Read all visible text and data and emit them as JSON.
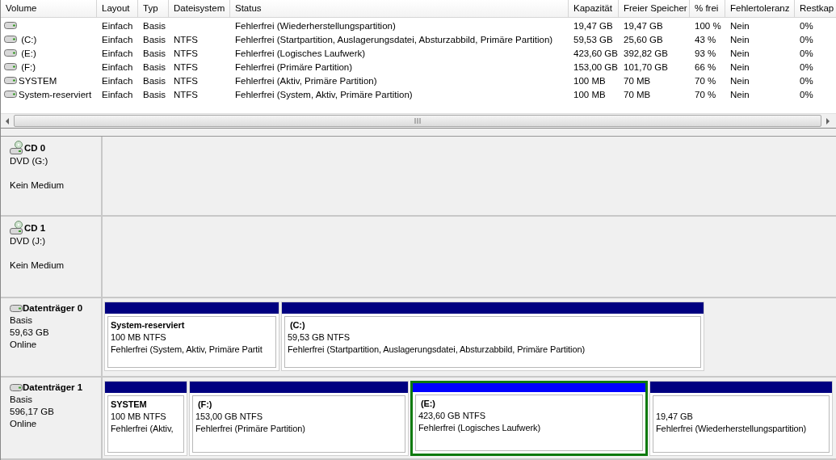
{
  "table": {
    "columns": [
      "Volume",
      "Layout",
      "Typ",
      "Dateisystem",
      "Status",
      "Kapazität",
      "Freier Speicher",
      "% frei",
      "Fehlertoleranz",
      "Restkap"
    ],
    "rows": [
      {
        "layout": "Einfach",
        "type": "Basis",
        "status": "Fehlerfrei (Wiederherstellungspartition)",
        "capacity": "19,47 GB",
        "free": "19,47 GB",
        "percent_free": "100 %",
        "fault_tolerance": "Nein",
        "column_10": "0%"
      },
      {
        "volume": " (C:)",
        "layout": "Einfach",
        "type": "Basis",
        "filesystem": "NTFS",
        "status": "Fehlerfrei (Startpartition, Auslagerungsdatei, Absturzabbild, Primäre Partition)",
        "capacity": "59,53 GB",
        "free": "25,60 GB",
        "percent_free": "43 %",
        "fault_tolerance": "Nein",
        "column_10": "0%"
      },
      {
        "volume": " (E:)",
        "layout": "Einfach",
        "type": "Basis",
        "filesystem": "NTFS",
        "status": "Fehlerfrei (Logisches Laufwerk)",
        "capacity": "423,60 GB",
        "free": "392,82 GB",
        "percent_free": "93 %",
        "fault_tolerance": "Nein",
        "column_10": "0%"
      },
      {
        "volume": " (F:)",
        "layout": "Einfach",
        "type": "Basis",
        "filesystem": "NTFS",
        "status": "Fehlerfrei (Primäre Partition)",
        "capacity": "153,00 GB",
        "free": "101,70 GB",
        "percent_free": "66 %",
        "fault_tolerance": "Nein",
        "column_10": "0%"
      },
      {
        "volume": "SYSTEM",
        "layout": "Einfach",
        "type": "Basis",
        "filesystem": "NTFS",
        "status": "Fehlerfrei (Aktiv, Primäre Partition)",
        "capacity": "100 MB",
        "free": "70 MB",
        "percent_free": "70 %",
        "fault_tolerance": "Nein",
        "column_10": "0%"
      },
      {
        "volume": "System-reserviert",
        "layout": "Einfach",
        "type": "Basis",
        "filesystem": "NTFS",
        "status": "Fehlerfrei (System, Aktiv, Primäre Partition)",
        "capacity": "100 MB",
        "free": "70 MB",
        "percent_free": "70 %",
        "fault_tolerance": "Nein",
        "column_10": "0%"
      }
    ]
  },
  "disks": [
    {
      "kind": "cd",
      "name": "CD 0",
      "lines": [
        "DVD (G:)",
        "Kein Medium"
      ]
    },
    {
      "kind": "cd",
      "name": "CD 1",
      "lines": [
        "DVD (J:)",
        "Kein Medium"
      ]
    },
    {
      "kind": "disk",
      "name": "Datenträger 0",
      "lines": [
        "Basis",
        "59,63 GB",
        "Online"
      ],
      "partitions": [
        {
          "label": "System-reserviert",
          "size": "100 MB NTFS",
          "status": "Fehlerfrei (System, Aktiv, Primäre Partit",
          "selected": false
        },
        {
          "label": " (C:)",
          "size": "59,53 GB NTFS",
          "status": "Fehlerfrei (Startpartition, Auslagerungsdatei, Absturzabbild, Primäre Partition)",
          "selected": false
        }
      ]
    },
    {
      "kind": "disk",
      "name": "Datenträger 1",
      "lines": [
        "Basis",
        "596,17 GB",
        "Online"
      ],
      "partitions": [
        {
          "label": "SYSTEM",
          "size": "100 MB NTFS",
          "status": "Fehlerfrei (Aktiv,",
          "selected": false
        },
        {
          "label": " (F:)",
          "size": "153,00 GB NTFS",
          "status": "Fehlerfrei (Primäre Partition)",
          "selected": false
        },
        {
          "label": " (E:)",
          "size": "423,60 GB NTFS",
          "status": "Fehlerfrei (Logisches Laufwerk)",
          "selected": true
        },
        {
          "size": "19,47 GB",
          "status": "Fehlerfrei (Wiederherstellungspartition)",
          "selected": false
        }
      ]
    }
  ]
}
